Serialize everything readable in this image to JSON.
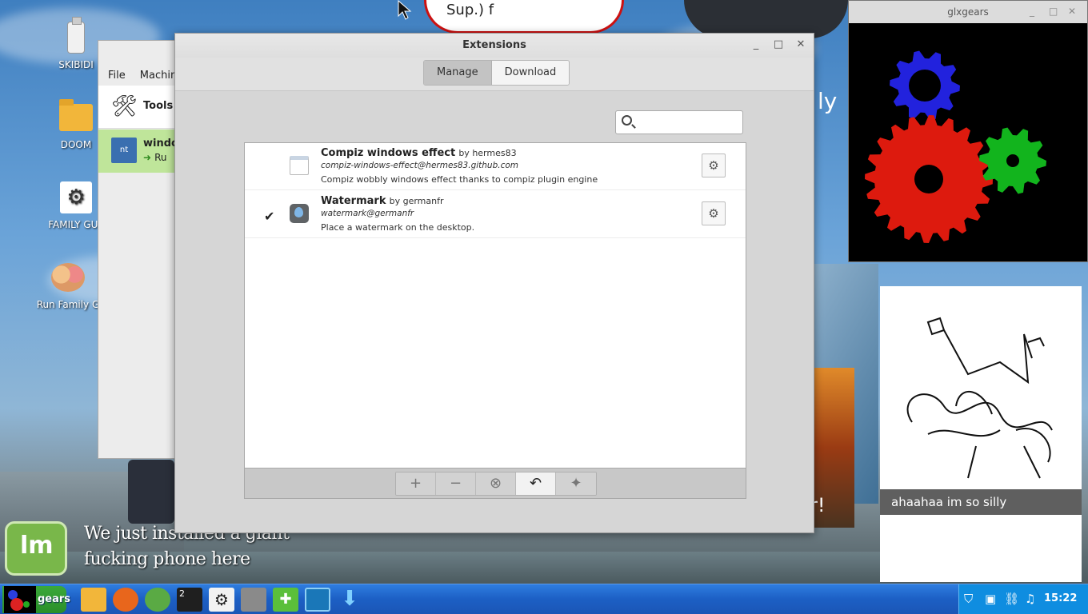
{
  "desktop": {
    "icons": [
      {
        "label": "SKIBIDI",
        "icon": "usb-drive-icon"
      },
      {
        "label": "DOOM",
        "icon": "folder-icon"
      },
      {
        "label": "FAMILY GUY",
        "icon": "settings-icon"
      },
      {
        "label": "Run Family G",
        "icon": "family-guy-icon"
      }
    ],
    "meme_caption_line1": "We just installed a giant",
    "meme_caption_line2": "fucking phone here",
    "sticker_text": "Sup.) f",
    "side_text": "ly",
    "side_text2": "r!"
  },
  "vbox": {
    "menu": [
      "File",
      "Machin"
    ],
    "tools_label": "Tools",
    "vm_name": "windo",
    "vm_state": "Ru"
  },
  "extensions": {
    "title": "Extensions",
    "tabs": [
      {
        "label": "Manage",
        "active": true
      },
      {
        "label": "Download",
        "active": false
      }
    ],
    "search": {
      "value": "",
      "placeholder": ""
    },
    "items": [
      {
        "name": "Compiz windows effect",
        "by": "by hermes83",
        "uuid": "compiz-windows-effect@hermes83.github.com",
        "description": "Compiz wobbly windows effect thanks to compiz plugin engine",
        "enabled": false,
        "icon": "window-icon"
      },
      {
        "name": "Watermark",
        "by": "by germanfr",
        "uuid": "watermark@germanfr",
        "description": "Place a watermark on the desktop.",
        "enabled": true,
        "icon": "water-drop-icon"
      }
    ],
    "bottom_buttons": [
      {
        "name": "add-icon",
        "glyph": "+",
        "enabled": false
      },
      {
        "name": "remove-icon",
        "glyph": "−",
        "enabled": false
      },
      {
        "name": "uninstall-icon",
        "glyph": "⊗",
        "enabled": false
      },
      {
        "name": "restore-icon",
        "glyph": "↶",
        "enabled": true
      },
      {
        "name": "more-icon",
        "glyph": "✦",
        "enabled": false
      }
    ]
  },
  "glxgears": {
    "title": "glxgears",
    "colors": {
      "blue": "#2222dd",
      "red": "#dd1a0e",
      "green": "#12b41d"
    }
  },
  "drawing": {
    "caption": "ahaahaa im so silly"
  },
  "taskbar": {
    "start_label": "gears",
    "terminal_badge": "2",
    "apps": [
      "files-icon",
      "firefox-icon",
      "spreadsheet-icon",
      "terminal-icon",
      "settings-icon",
      "toggle-icon",
      "extensions-icon",
      "system-monitor-icon",
      "download-icon"
    ],
    "clock": "15:22"
  },
  "colors": {
    "taskbar": "#1c5fc4",
    "start": "#2a8f29",
    "accent": "#79b74a"
  }
}
